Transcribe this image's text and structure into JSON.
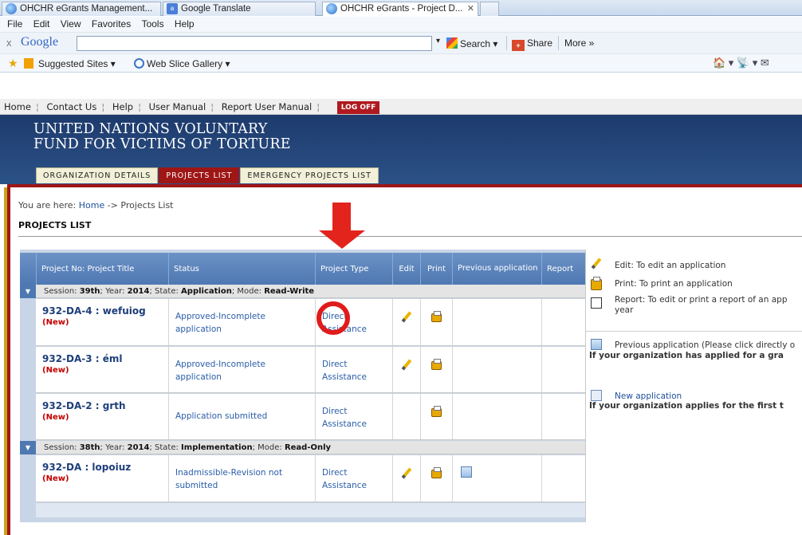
{
  "browser": {
    "tabs": [
      {
        "label": "OHCHR eGrants Management...",
        "icon": "ie-icon"
      },
      {
        "label": "Google Translate",
        "icon": "google-translate-icon"
      },
      {
        "label": "OHCHR eGrants - Project D...",
        "icon": "ie-icon",
        "active": true
      }
    ],
    "close_glyph": "✕",
    "menu": [
      "File",
      "Edit",
      "View",
      "Favorites",
      "Tools",
      "Help"
    ],
    "toolbar": {
      "close_glyph": "x",
      "google_logo": "Google",
      "search_label": "Search",
      "share_label": "Share",
      "more_label": "More »"
    },
    "favorites": {
      "suggested_sites": "Suggested Sites ▾",
      "web_slice_gallery": "Web Slice Gallery ▾",
      "right_tools": "🏠 ▾  📡 ▾  ✉"
    }
  },
  "site": {
    "topnav": [
      "Home",
      "Contact Us",
      "Help",
      "User Manual",
      "Report User Manual"
    ],
    "logoff": "LOG OFF",
    "banner_line1": "UNITED NATIONS VOLUNTARY",
    "banner_line2": "FUND FOR VICTIMS OF TORTURE",
    "tabs": [
      {
        "label": "ORGANIZATION DETAILS",
        "active": false
      },
      {
        "label": "PROJECTS LIST",
        "active": true
      },
      {
        "label": "EMERGENCY PROJECTS LIST",
        "active": false
      }
    ],
    "accent_color": "#9e1616",
    "header_color": "#1d3a6c"
  },
  "page": {
    "breadcrumb_prefix": "You are here: ",
    "breadcrumb_home": "Home",
    "breadcrumb_sep": " -> ",
    "breadcrumb_current": "Projects List",
    "title": "PROJECTS LIST"
  },
  "table": {
    "headers": [
      "Project No: Project Title",
      "Status",
      "Project Type",
      "Edit",
      "Print",
      "Previous application",
      "Report"
    ],
    "sessions": [
      {
        "prefix": "Session: ",
        "session": "39th",
        "year_label": "; Year: ",
        "year": "2014",
        "state_label": "; State: ",
        "state": "Application",
        "mode_label": "; Mode: ",
        "mode": "Read-Write"
      },
      {
        "prefix": "Session: ",
        "session": "38th",
        "year_label": "; Year: ",
        "year": "2014",
        "state_label": "; State: ",
        "state": "Implementation",
        "mode_label": "; Mode: ",
        "mode": "Read-Only"
      }
    ],
    "rows": [
      {
        "project": "932-DA-4 : wefuiog",
        "tag": "(New)",
        "status": "Approved-Incomplete application",
        "type": "Direct Assistance",
        "edit": true,
        "print": true,
        "previous": false
      },
      {
        "project": "932-DA-3 : éml",
        "tag": "(New)",
        "status": "Approved-Incomplete application",
        "type": "Direct Assistance",
        "edit": true,
        "print": true,
        "previous": false
      },
      {
        "project": "932-DA-2 : grth",
        "tag": "(New)",
        "status": "Application submitted",
        "type": "Direct Assistance",
        "edit": false,
        "print": true,
        "previous": false
      },
      {
        "project": "932-DA : lopoiuz",
        "tag": "(New)",
        "status": "Inadmissible-Revision not submitted",
        "type": "Direct Assistance",
        "edit": true,
        "print": true,
        "previous": true
      }
    ]
  },
  "legend": {
    "edit": "Edit: To edit an application",
    "print": "Print: To print an application",
    "report_line1": "Report: To edit or print a report of an app",
    "report_line2": "year",
    "previous": "Previous application (Please click directly o",
    "previous_bold": "If your organization has applied for a gra",
    "new_app": "New application",
    "new_app_bold": "If your organization applies for the first t"
  }
}
